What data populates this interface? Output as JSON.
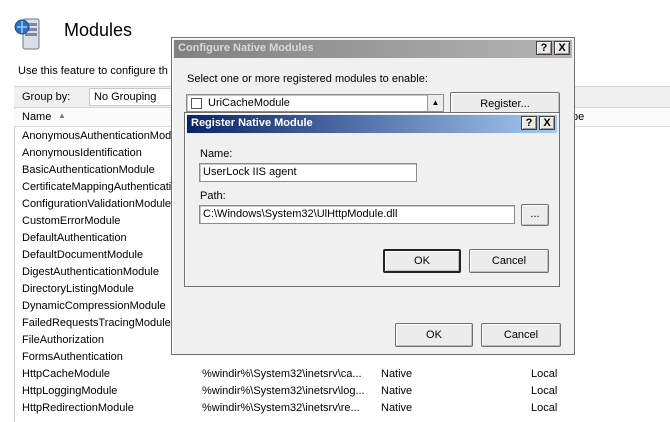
{
  "page": {
    "title": "Modules",
    "description": "Use this feature to configure th",
    "group_by_label": "Group by:",
    "group_by_value": "No Grouping",
    "columns": {
      "name": "Name",
      "type": "pe"
    }
  },
  "modules": [
    {
      "name": "AnonymousAuthenticationModule",
      "code": "",
      "type": "",
      "entry": ""
    },
    {
      "name": "AnonymousIdentification",
      "code": "",
      "type": "",
      "entry": ""
    },
    {
      "name": "BasicAuthenticationModule",
      "code": "",
      "type": "",
      "entry": ""
    },
    {
      "name": "CertificateMappingAuthentication",
      "code": "",
      "type": "",
      "entry": ""
    },
    {
      "name": "ConfigurationValidationModule",
      "code": "",
      "type": "",
      "entry": ""
    },
    {
      "name": "CustomErrorModule",
      "code": "",
      "type": "",
      "entry": ""
    },
    {
      "name": "DefaultAuthentication",
      "code": "",
      "type": "",
      "entry": ""
    },
    {
      "name": "DefaultDocumentModule",
      "code": "",
      "type": "",
      "entry": ""
    },
    {
      "name": "DigestAuthenticationModule",
      "code": "",
      "type": "",
      "entry": ""
    },
    {
      "name": "DirectoryListingModule",
      "code": "",
      "type": "",
      "entry": ""
    },
    {
      "name": "DynamicCompressionModule",
      "code": "",
      "type": "",
      "entry": ""
    },
    {
      "name": "FailedRequestsTracingModule",
      "code": "",
      "type": "",
      "entry": ""
    },
    {
      "name": "FileAuthorization",
      "code": "",
      "type": "",
      "entry": ""
    },
    {
      "name": "FormsAuthentication",
      "code": "",
      "type": "",
      "entry": ""
    },
    {
      "name": "HttpCacheModule",
      "code": "%windir%\\System32\\inetsrv\\ca...",
      "type": "Native",
      "entry": "Local"
    },
    {
      "name": "HttpLoggingModule",
      "code": "%windir%\\System32\\inetsrv\\log...",
      "type": "Native",
      "entry": "Local"
    },
    {
      "name": "HttpRedirectionModule",
      "code": "%windir%\\System32\\inetsrv\\re...",
      "type": "Native",
      "entry": "Local"
    }
  ],
  "configure_dialog": {
    "title": "Configure Native Modules",
    "help_label": "?",
    "close_label": "X",
    "prompt": "Select one or more registered modules to enable:",
    "first_module": "UriCacheModule",
    "register_label": "Register...",
    "ok_label": "OK",
    "cancel_label": "Cancel"
  },
  "register_dialog": {
    "title": "Register Native Module",
    "help_label": "?",
    "close_label": "X",
    "name_label": "Name:",
    "name_value": "UserLock IIS agent",
    "path_label": "Path:",
    "path_value": "C:\\Windows\\System32\\UlHttpModule.dll",
    "browse_label": "...",
    "ok_label": "OK",
    "cancel_label": "Cancel"
  },
  "colors": {
    "dialog_title_active": "#0a246a",
    "dialog_title_inactive": "#808080",
    "dialog_face": "#f0f0f0"
  }
}
